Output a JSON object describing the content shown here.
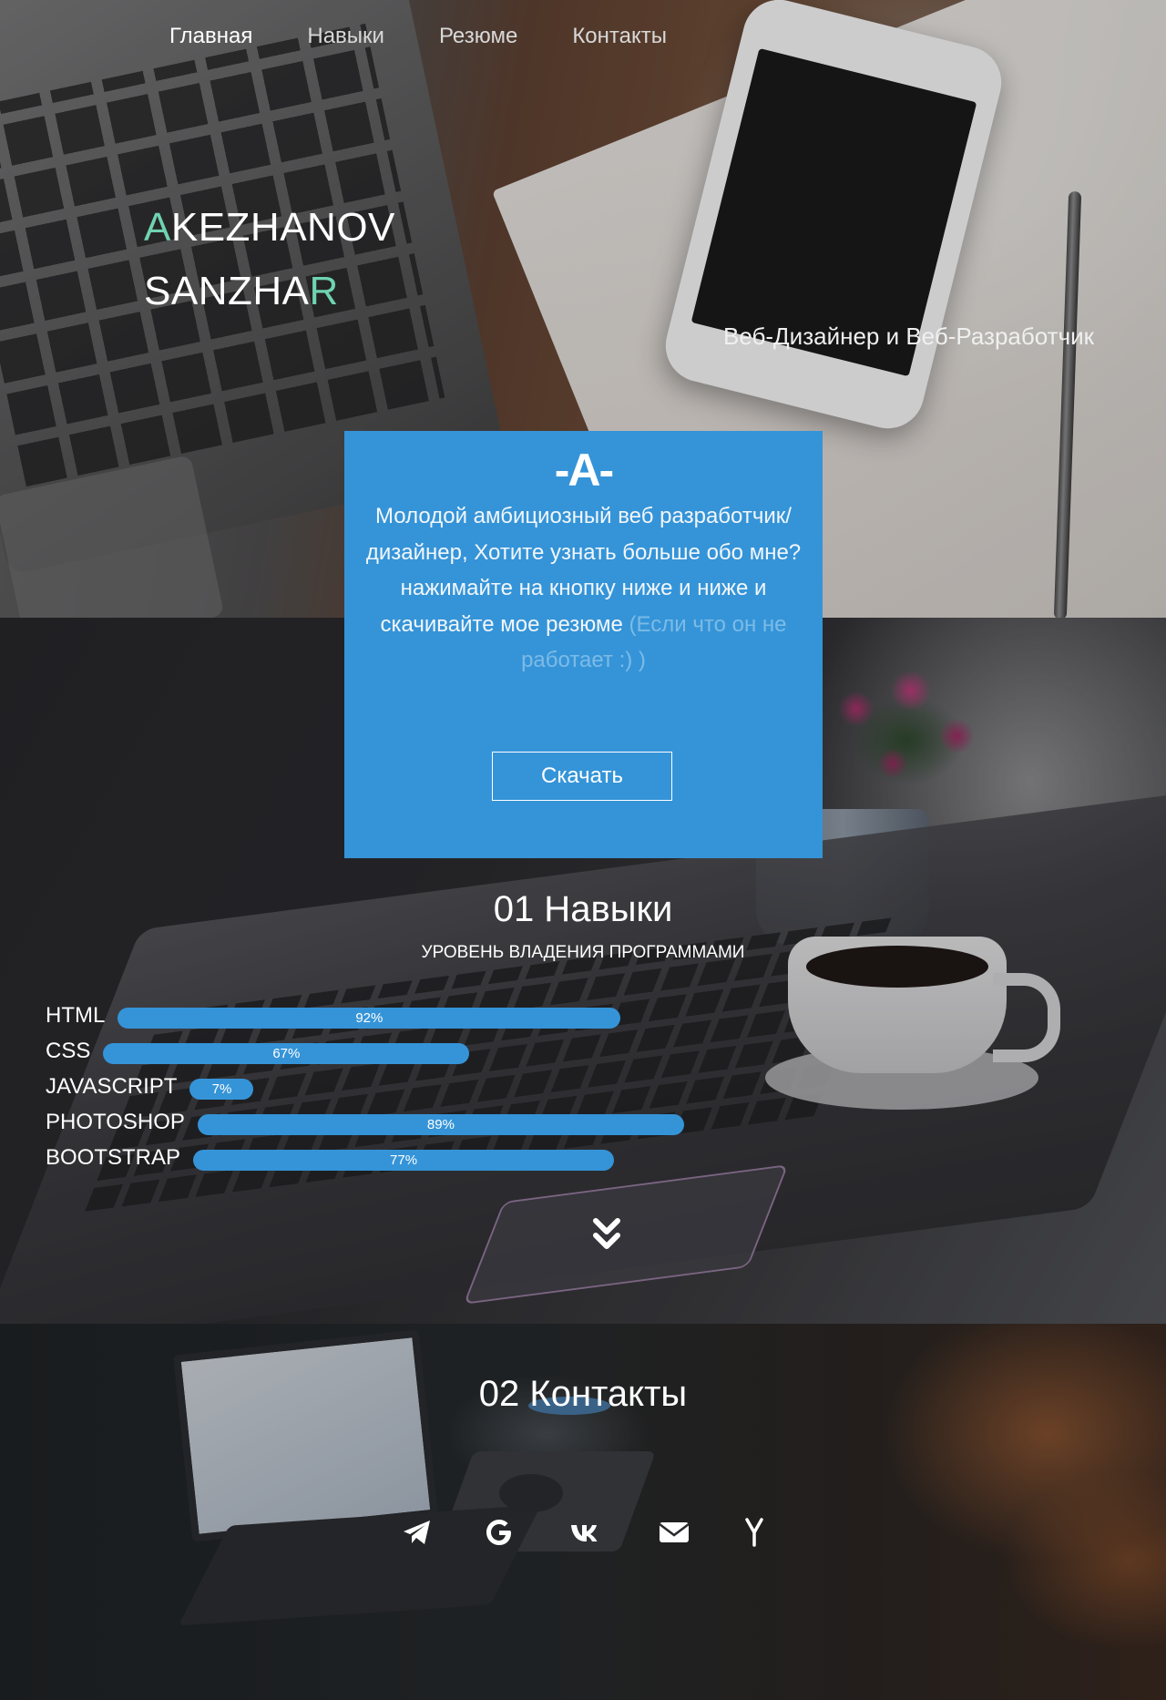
{
  "nav": {
    "items": [
      {
        "label": "Главная",
        "active": true
      },
      {
        "label": "Навыки",
        "active": false
      },
      {
        "label": "Резюме",
        "active": false
      },
      {
        "label": "Контакты",
        "active": false
      }
    ]
  },
  "hero": {
    "name_line1_accent": "A",
    "name_line1_rest": "KEZHANOV",
    "name_line2_rest": "SANZHA",
    "name_line2_accent": "R",
    "role": "Веб-Дизайнер и Веб-Разработчик"
  },
  "card": {
    "logo": "-A-",
    "text": "Молодой амбициозный веб разработчик/ дизайнер, Хотите узнать больше обо мне? нажимайте на кнопку ниже и ниже и скачивайте мое резюме",
    "muted_text": "(Если что он не работает :) )",
    "button_label": "Скачать"
  },
  "skills": {
    "title": "01 Навыки",
    "subtitle": "УРОВЕНЬ ВЛАДЕНИЯ ПРОГРАММАМИ",
    "items": [
      {
        "name": "HTML",
        "percent_label": "92%",
        "percent": 92
      },
      {
        "name": "CSS",
        "percent_label": "67%",
        "percent": 67
      },
      {
        "name": "JAVASCRIPT",
        "percent_label": "7%",
        "percent": 7
      },
      {
        "name": "PHOTOSHOP",
        "percent_label": "89%",
        "percent": 89
      },
      {
        "name": "BOOTSTRAP",
        "percent_label": "77%",
        "percent": 77
      }
    ],
    "scroll_icon": "double-chevron-down-icon"
  },
  "contacts": {
    "title": "02 Контакты",
    "icons": [
      "telegram-icon",
      "google-icon",
      "vk-icon",
      "mail-icon",
      "yandex-icon"
    ]
  },
  "colors": {
    "accent_blue": "#3594d8",
    "accent_green": "#6fd3b0",
    "muted_blue": "#7cbbe6"
  }
}
